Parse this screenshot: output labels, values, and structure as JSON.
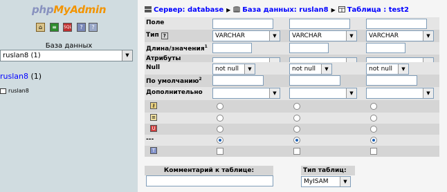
{
  "left": {
    "logo": {
      "php": "php",
      "my": "My",
      "admin": "Admin"
    },
    "db_label": "База данных",
    "db_select": "ruslan8  (1)",
    "db_link": "ruslan8",
    "db_link_count": "(1)",
    "table_link": "ruslan8"
  },
  "breadcrumb": {
    "server": "Сервер: database",
    "database": "База данных: ruslan8",
    "table": "Таблица : test2"
  },
  "fields": {
    "labels": {
      "name": "Поле",
      "type": "Тип",
      "length": "Длина/значения",
      "attributes": "Атрибуты",
      "null": "Null",
      "default": "По умолчанию",
      "extra": "Дополнительно",
      "none": "---"
    },
    "sup_length": "1",
    "sup_default": "2",
    "type_help": "?",
    "type_value": "VARCHAR",
    "null_value": "not null"
  },
  "footer": {
    "comment_label": "Комментарий к таблице:",
    "type_label": "Тип таблиц:",
    "type_help": "?",
    "engine": "MyISAM"
  },
  "colors": {
    "left_bg": "#d0dce0",
    "right_bg": "#f5f5f5",
    "row_dark": "#d5d5d5",
    "row_light": "#e5e5e5"
  }
}
